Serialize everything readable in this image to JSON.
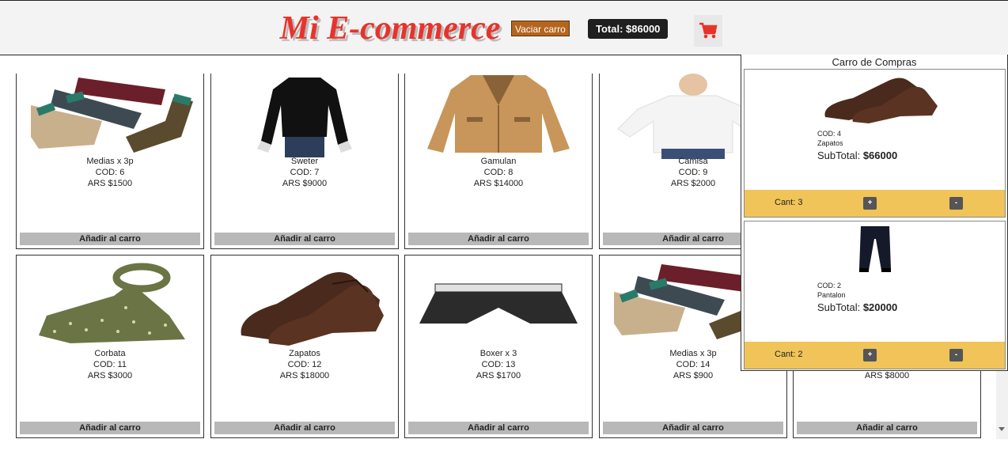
{
  "header": {
    "logo_text": "Mi E-commerce",
    "clear_cart_label": "Vaciar carro",
    "total_label": "Total: $86000",
    "cart_icon": "shopping-cart-icon",
    "accent_color": "#e8332b"
  },
  "products": [
    {
      "name": "Medias x 3p",
      "cod": "COD: 6",
      "price": "ARS $1500",
      "image": "socks",
      "button": "Añadir al carro"
    },
    {
      "name": "Sweter",
      "cod": "COD: 7",
      "price": "ARS $9000",
      "image": "sweater",
      "button": "Añadir al carro"
    },
    {
      "name": "Gamulan",
      "cod": "COD: 8",
      "price": "ARS $14000",
      "image": "coat",
      "button": "Añadir al carro"
    },
    {
      "name": "Camisa",
      "cod": "COD: 9",
      "price": "ARS $2000",
      "image": "shirt",
      "button": "Añadir al carro"
    },
    {
      "name": "Corbata",
      "cod": "COD: 11",
      "price": "ARS $3000",
      "image": "tie",
      "button": "Añadir al carro"
    },
    {
      "name": "Zapatos",
      "cod": "COD: 12",
      "price": "ARS $18000",
      "image": "shoes",
      "button": "Añadir al carro"
    },
    {
      "name": "Boxer x 3",
      "cod": "COD: 13",
      "price": "ARS $1700",
      "image": "boxer",
      "button": "Añadir al carro"
    },
    {
      "name": "Medias x 3p",
      "cod": "COD: 14",
      "price": "ARS $900",
      "image": "socks",
      "button": "Añadir al carro"
    },
    {
      "name": "",
      "cod": "",
      "price": "ARS $8000",
      "image": "",
      "button": "Añadir al carro"
    }
  ],
  "cart": {
    "title": "Carro de Compras",
    "items": [
      {
        "cod": "COD: 4",
        "name": "Zapatos",
        "subtotal_label": "SubTotal:",
        "subtotal": "$66000",
        "qty": "Cant: 3",
        "plus": "+",
        "minus": "-",
        "image": "shoes"
      },
      {
        "cod": "COD: 2",
        "name": "Pantalon",
        "subtotal_label": "SubTotal:",
        "subtotal": "$20000",
        "qty": "Cant: 2",
        "plus": "+",
        "minus": "-",
        "image": "pants"
      }
    ]
  }
}
